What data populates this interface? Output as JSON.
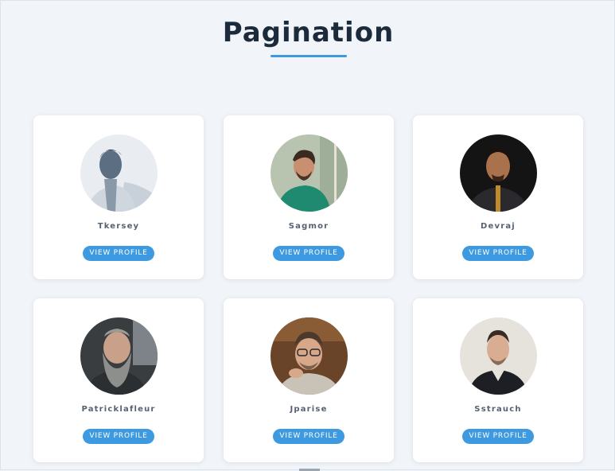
{
  "page": {
    "title": "Pagination"
  },
  "cards": [
    {
      "name": "Tkersey",
      "button": "VIEW PROFILE",
      "avatar": "profile-photo"
    },
    {
      "name": "Sagmor",
      "button": "VIEW PROFILE",
      "avatar": "profile-photo"
    },
    {
      "name": "Devraj",
      "button": "VIEW PROFILE",
      "avatar": "profile-photo"
    },
    {
      "name": "Patricklafleur",
      "button": "VIEW PROFILE",
      "avatar": "profile-photo"
    },
    {
      "name": "Jparise",
      "button": "VIEW PROFILE",
      "avatar": "profile-photo"
    },
    {
      "name": "Sstrauch",
      "button": "VIEW PROFILE",
      "avatar": "profile-photo"
    }
  ],
  "colors": {
    "accent": "#3d9ae0",
    "title": "#1c2b3c",
    "background": "#f1f4f8"
  }
}
